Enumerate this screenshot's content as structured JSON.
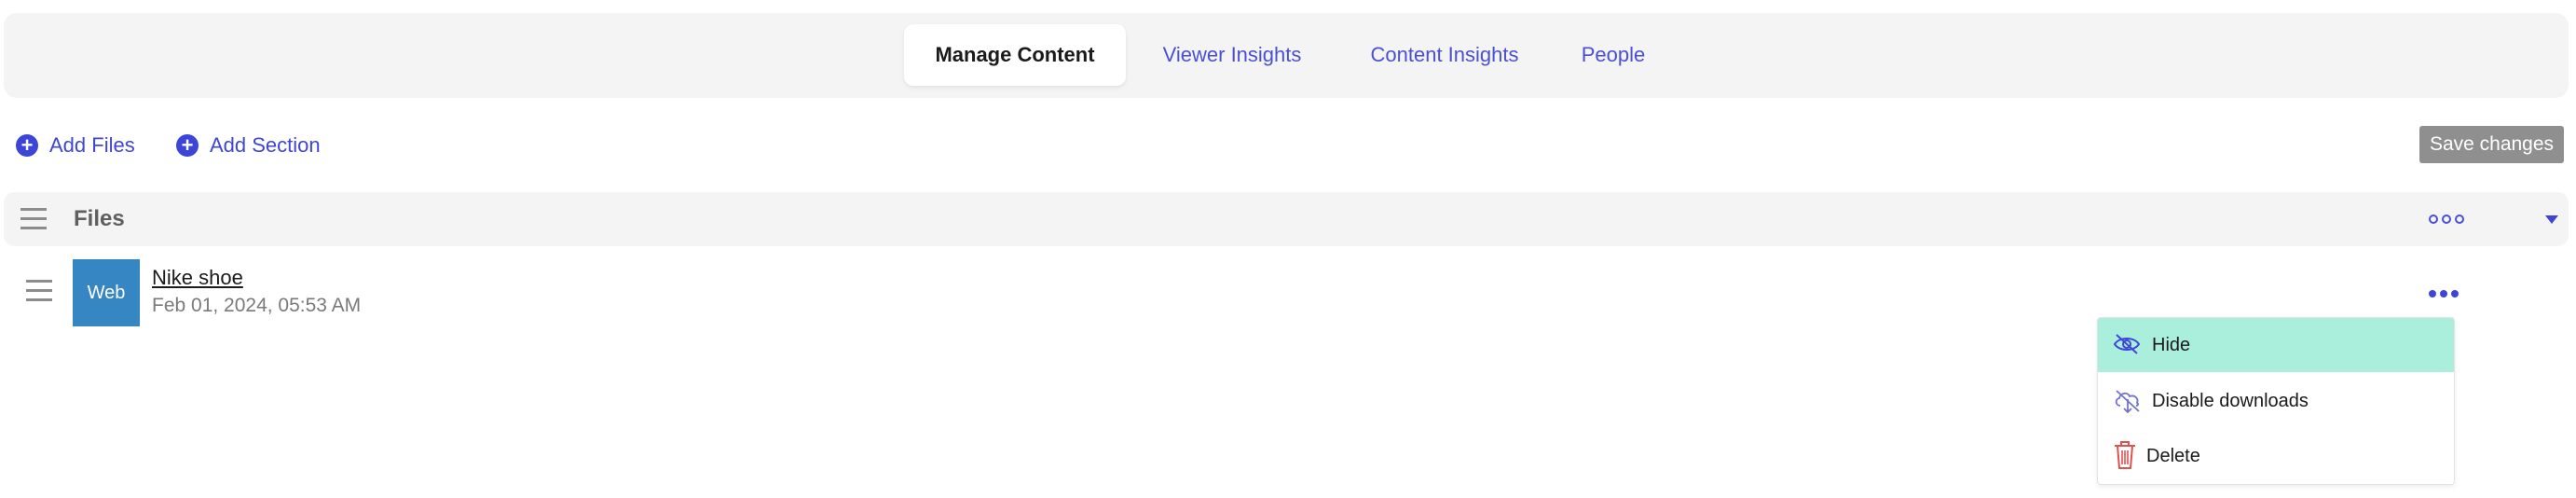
{
  "tabs": {
    "manage": "Manage Content",
    "viewer": "Viewer Insights",
    "content": "Content Insights",
    "people": "People"
  },
  "actions": {
    "add_files": "Add Files",
    "add_section": "Add Section",
    "save": "Save changes"
  },
  "section": {
    "title": "Files"
  },
  "file": {
    "thumb_label": "Web",
    "name": "Nike shoe",
    "date": "Feb 01, 2024, 05:53 AM"
  },
  "menu": {
    "hide": "Hide",
    "disable_downloads": "Disable downloads",
    "delete": "Delete"
  },
  "icons": {
    "add": "plus-circle-icon",
    "drag": "drag-handle-icon",
    "more": "ellipsis-icon",
    "collapse": "caret-down-icon",
    "hide": "eye-slash-icon",
    "disable_downloads": "cloud-download-off-icon",
    "delete": "trash-icon"
  },
  "colors": {
    "accent": "#3f45d6",
    "thumb": "#3686c3",
    "menu_highlight": "#a9efdc",
    "delete": "#e0524f",
    "save_disabled": "#8f8f8f"
  }
}
